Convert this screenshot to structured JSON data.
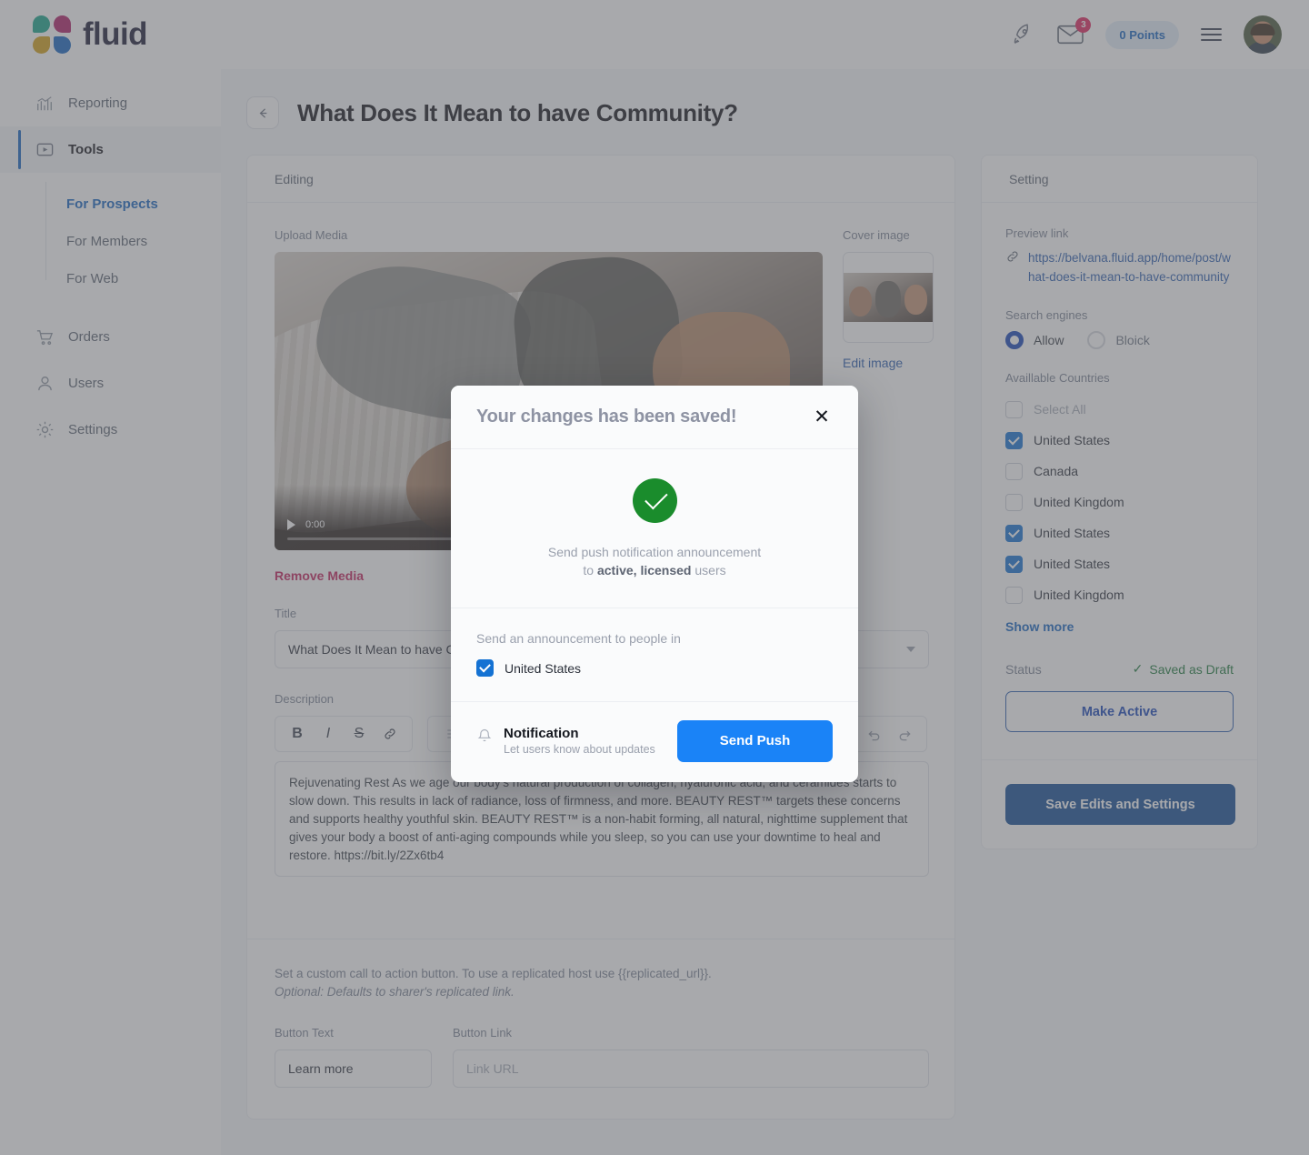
{
  "header": {
    "logo_text": "fluid",
    "rocket_icon": "rocket-icon",
    "mail_icon": "mail-icon",
    "mail_badge": "3",
    "points_label": "0 Points",
    "menu_icon": "hamburger-icon",
    "avatar": "user-avatar"
  },
  "sidebar": {
    "items": [
      {
        "label": "Reporting",
        "icon": "chart-icon"
      },
      {
        "label": "Tools",
        "icon": "video-player-icon"
      },
      {
        "label": "Orders",
        "icon": "cart-icon"
      },
      {
        "label": "Users",
        "icon": "person-icon"
      },
      {
        "label": "Settings",
        "icon": "gear-icon"
      }
    ],
    "subitems": [
      {
        "label": "For Prospects"
      },
      {
        "label": "For Members"
      },
      {
        "label": "For Web"
      }
    ]
  },
  "page": {
    "title": "What Does It Mean to have Community?",
    "back_icon": "arrow-left-icon"
  },
  "editing": {
    "card_title": "Editing",
    "upload_media_label": "Upload Media",
    "cover_image_label": "Cover image",
    "edit_image_link": "Edit image",
    "remove_media_label": "Remove Media",
    "video_time": "0:00",
    "title_label": "Title",
    "title_value": "What Does It Mean to have Community?",
    "description_label": "Description",
    "description_value": "Rejuvenating Rest As we age our body's natural production of collagen, hyaluronic acid, and ceramides starts to slow down. This results in lack of radiance, loss of firmness, and more. BEAUTY REST™ targets these concerns and supports healthy youthful skin. BEAUTY REST™ is a non-habit forming, all natural, nighttime supplement that gives your body a boost of anti-aging compounds while you sleep, so you can use your downtime to heal and restore. https://bit.ly/2Zx6tb4",
    "toolbar": {
      "bold": "B",
      "italic": "I",
      "strike": "S",
      "link_icon": "link-icon",
      "undo_icon": "undo-icon",
      "redo_icon": "redo-icon"
    },
    "cta_note_line1": "Set a custom call to action button. To use a replicated host use {{replicated_url}}.",
    "cta_note_line2": "Optional: Defaults to sharer's replicated link.",
    "button_text_label": "Button Text",
    "button_text_value": "Learn more",
    "button_link_label": "Button Link",
    "button_link_placeholder": "Link URL"
  },
  "setting": {
    "card_title": "Setting",
    "preview_link_label": "Preview link",
    "link_icon": "link-chain-icon",
    "preview_link_url": "https://belvana.fluid.app/home/post/what-does-it-mean-to-have-community",
    "search_engines_label": "Search engines",
    "search_engines_options": [
      {
        "label": "Allow",
        "selected": true
      },
      {
        "label": "Bloick",
        "selected": false
      }
    ],
    "countries_label": "Availlable Countries",
    "countries": [
      {
        "label": "Select All",
        "checked": false,
        "muted": true
      },
      {
        "label": "United States",
        "checked": true,
        "muted": false
      },
      {
        "label": "Canada",
        "checked": false,
        "muted": false
      },
      {
        "label": "United Kingdom",
        "checked": false,
        "muted": false
      },
      {
        "label": "United States",
        "checked": true,
        "muted": false
      },
      {
        "label": "United States",
        "checked": true,
        "muted": false
      },
      {
        "label": "United Kingdom",
        "checked": false,
        "muted": false
      }
    ],
    "show_more_label": "Show more",
    "status_label": "Status",
    "status_value": "Saved as Draft",
    "status_check_icon": "check-icon",
    "make_active_label": "Make Active",
    "save_label": "Save Edits and Settings"
  },
  "modal": {
    "title": "Your changes has been saved!",
    "close_icon": "close-icon",
    "success_icon": "check-circle-icon",
    "message_line1": "Send push notification announcement",
    "message_prefix": "to ",
    "message_bold": "active, licensed",
    "message_suffix": " users",
    "section_label": "Send an announcement to people in",
    "country_label": "United States",
    "country_checked": true,
    "bell_icon": "bell-icon",
    "notification_title": "Notification",
    "notification_sub": "Let users know about updates",
    "send_push_label": "Send Push"
  },
  "colors": {
    "accent_blue": "#1464c0",
    "button_blue": "#1a83f7",
    "save_blue": "#134d96",
    "success_green": "#1a8c2c",
    "status_green": "#1e7a3c",
    "danger_pink": "#c4215c"
  }
}
